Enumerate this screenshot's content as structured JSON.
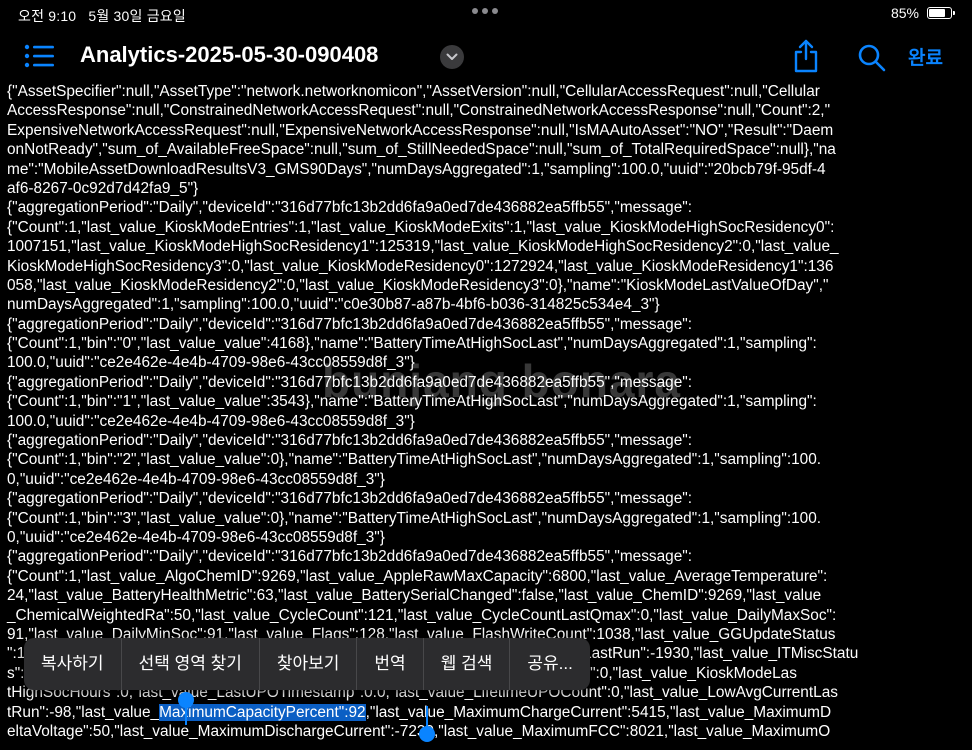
{
  "status_bar": {
    "time": "오전 9:10",
    "date": "5월 30일 금요일",
    "battery_percent": "85%",
    "battery_level": 0.85
  },
  "nav": {
    "title": "Analytics-2025-05-30-090408",
    "done_label": "완료",
    "accent_color": "#0a84ff"
  },
  "content_lines": [
    "{\"AssetSpecifier\":null,\"AssetType\":\"network.networknomicon\",\"AssetVersion\":null,\"CellularAccessRequest\":null,\"Cellular",
    "AccessResponse\":null,\"ConstrainedNetworkAccessRequest\":null,\"ConstrainedNetworkAccessResponse\":null,\"Count\":2,\"",
    "ExpensiveNetworkAccessRequest\":null,\"ExpensiveNetworkAccessResponse\":null,\"IsMAAutoAsset\":\"NO\",\"Result\":\"Daem",
    "onNotReady\",\"sum_of_AvailableFreeSpace\":null,\"sum_of_StillNeededSpace\":null,\"sum_of_TotalRequiredSpace\":null},\"na",
    "me\":\"MobileAssetDownloadResultsV3_GMS90Days\",\"numDaysAggregated\":1,\"sampling\":100.0,\"uuid\":\"20bcb79f-95df-4",
    "af6-8267-0c92d7d42fa9_5\"}",
    "{\"aggregationPeriod\":\"Daily\",\"deviceId\":\"316d77bfc13b2dd6fa9a0ed7de436882ea5ffb55\",\"message\":",
    "{\"Count\":1,\"last_value_KioskModeEntries\":1,\"last_value_KioskModeExits\":1,\"last_value_KioskModeHighSocResidency0\":",
    "1007151,\"last_value_KioskModeHighSocResidency1\":125319,\"last_value_KioskModeHighSocResidency2\":0,\"last_value_",
    "KioskModeHighSocResidency3\":0,\"last_value_KioskModeResidency0\":1272924,\"last_value_KioskModeResidency1\":136",
    "058,\"last_value_KioskModeResidency2\":0,\"last_value_KioskModeResidency3\":0},\"name\":\"KioskModeLastValueOfDay\",\"",
    "numDaysAggregated\":1,\"sampling\":100.0,\"uuid\":\"c0e30b87-a87b-4bf6-b036-314825c534e4_3\"}",
    "{\"aggregationPeriod\":\"Daily\",\"deviceId\":\"316d77bfc13b2dd6fa9a0ed7de436882ea5ffb55\",\"message\":",
    "{\"Count\":1,\"bin\":\"0\",\"last_value_value\":4168},\"name\":\"BatteryTimeAtHighSocLast\",\"numDaysAggregated\":1,\"sampling\":",
    "100.0,\"uuid\":\"ce2e462e-4e4b-4709-98e6-43cc08559d8f_3\"}",
    "{\"aggregationPeriod\":\"Daily\",\"deviceId\":\"316d77bfc13b2dd6fa9a0ed7de436882ea5ffb55\",\"message\":",
    "{\"Count\":1,\"bin\":\"1\",\"last_value_value\":3543},\"name\":\"BatteryTimeAtHighSocLast\",\"numDaysAggregated\":1,\"sampling\":",
    "100.0,\"uuid\":\"ce2e462e-4e4b-4709-98e6-43cc08559d8f_3\"}",
    "{\"aggregationPeriod\":\"Daily\",\"deviceId\":\"316d77bfc13b2dd6fa9a0ed7de436882ea5ffb55\",\"message\":",
    "{\"Count\":1,\"bin\":\"2\",\"last_value_value\":0},\"name\":\"BatteryTimeAtHighSocLast\",\"numDaysAggregated\":1,\"sampling\":100.",
    "0,\"uuid\":\"ce2e462e-4e4b-4709-98e6-43cc08559d8f_3\"}",
    "{\"aggregationPeriod\":\"Daily\",\"deviceId\":\"316d77bfc13b2dd6fa9a0ed7de436882ea5ffb55\",\"message\":",
    "{\"Count\":1,\"bin\":\"3\",\"last_value_value\":0},\"name\":\"BatteryTimeAtHighSocLast\",\"numDaysAggregated\":1,\"sampling\":100.",
    "0,\"uuid\":\"ce2e462e-4e4b-4709-98e6-43cc08559d8f_3\"}",
    "{\"aggregationPeriod\":\"Daily\",\"deviceId\":\"316d77bfc13b2dd6fa9a0ed7de436882ea5ffb55\",\"message\":",
    "{\"Count\":1,\"last_value_AlgoChemID\":9269,\"last_value_AppleRawMaxCapacity\":6800,\"last_value_AverageTemperature\":",
    "24,\"last_value_BatteryHealthMetric\":63,\"last_value_BatterySerialChanged\":false,\"last_value_ChemID\":9269,\"last_value",
    "_ChemicalWeightedRa\":50,\"last_value_CycleCount\":121,\"last_value_CycleCountLastQmax\":0,\"last_value_DailyMaxSoc\":",
    "91,\"last_value_DailyMinSoc\":91,\"last_value_Flags\":128,\"last_value_FlashWriteCount\":1038,\"last_value_GGUpdateStatus",
    "\":1,\"last_value_ITMiscStatus\":0,\"last_value_KioskModeHighSocDays\":0,\"last_value_LastRun\":-1930,\"last_value_ITMiscStatu",
    "s\":0,\"last_value_KioskModeHighSocDays\":0,\"last_value_KioskModeHighSocSeconds\":0,\"last_value_KioskModeLas",
    "tHighSocHours\":0,\"last_value_LastUPOTimestamp\":0.0,\"last_value_LifetimeUPOCount\":0,\"last_value_LowAvgCurrentLas"
  ],
  "line_split": {
    "before": "tRun\":-98,\"last_value_",
    "selected": "MaximumCapacityPercent\":92",
    "after": ",\"last_value_MaximumChargeCurrent\":5415,\"last_value_MaximumD"
  },
  "last_line": "eltaVoltage\":50,\"last_value_MaximumDischargeCurrent\":-7239,\"last_value_MaximumFCC\":8021,\"last_value_MaximumO",
  "watermark": "bunjang bonara",
  "context_menu": [
    "복사하기",
    "선택 영역 찾기",
    "찾아보기",
    "번역",
    "웹 검색",
    "공유..."
  ]
}
